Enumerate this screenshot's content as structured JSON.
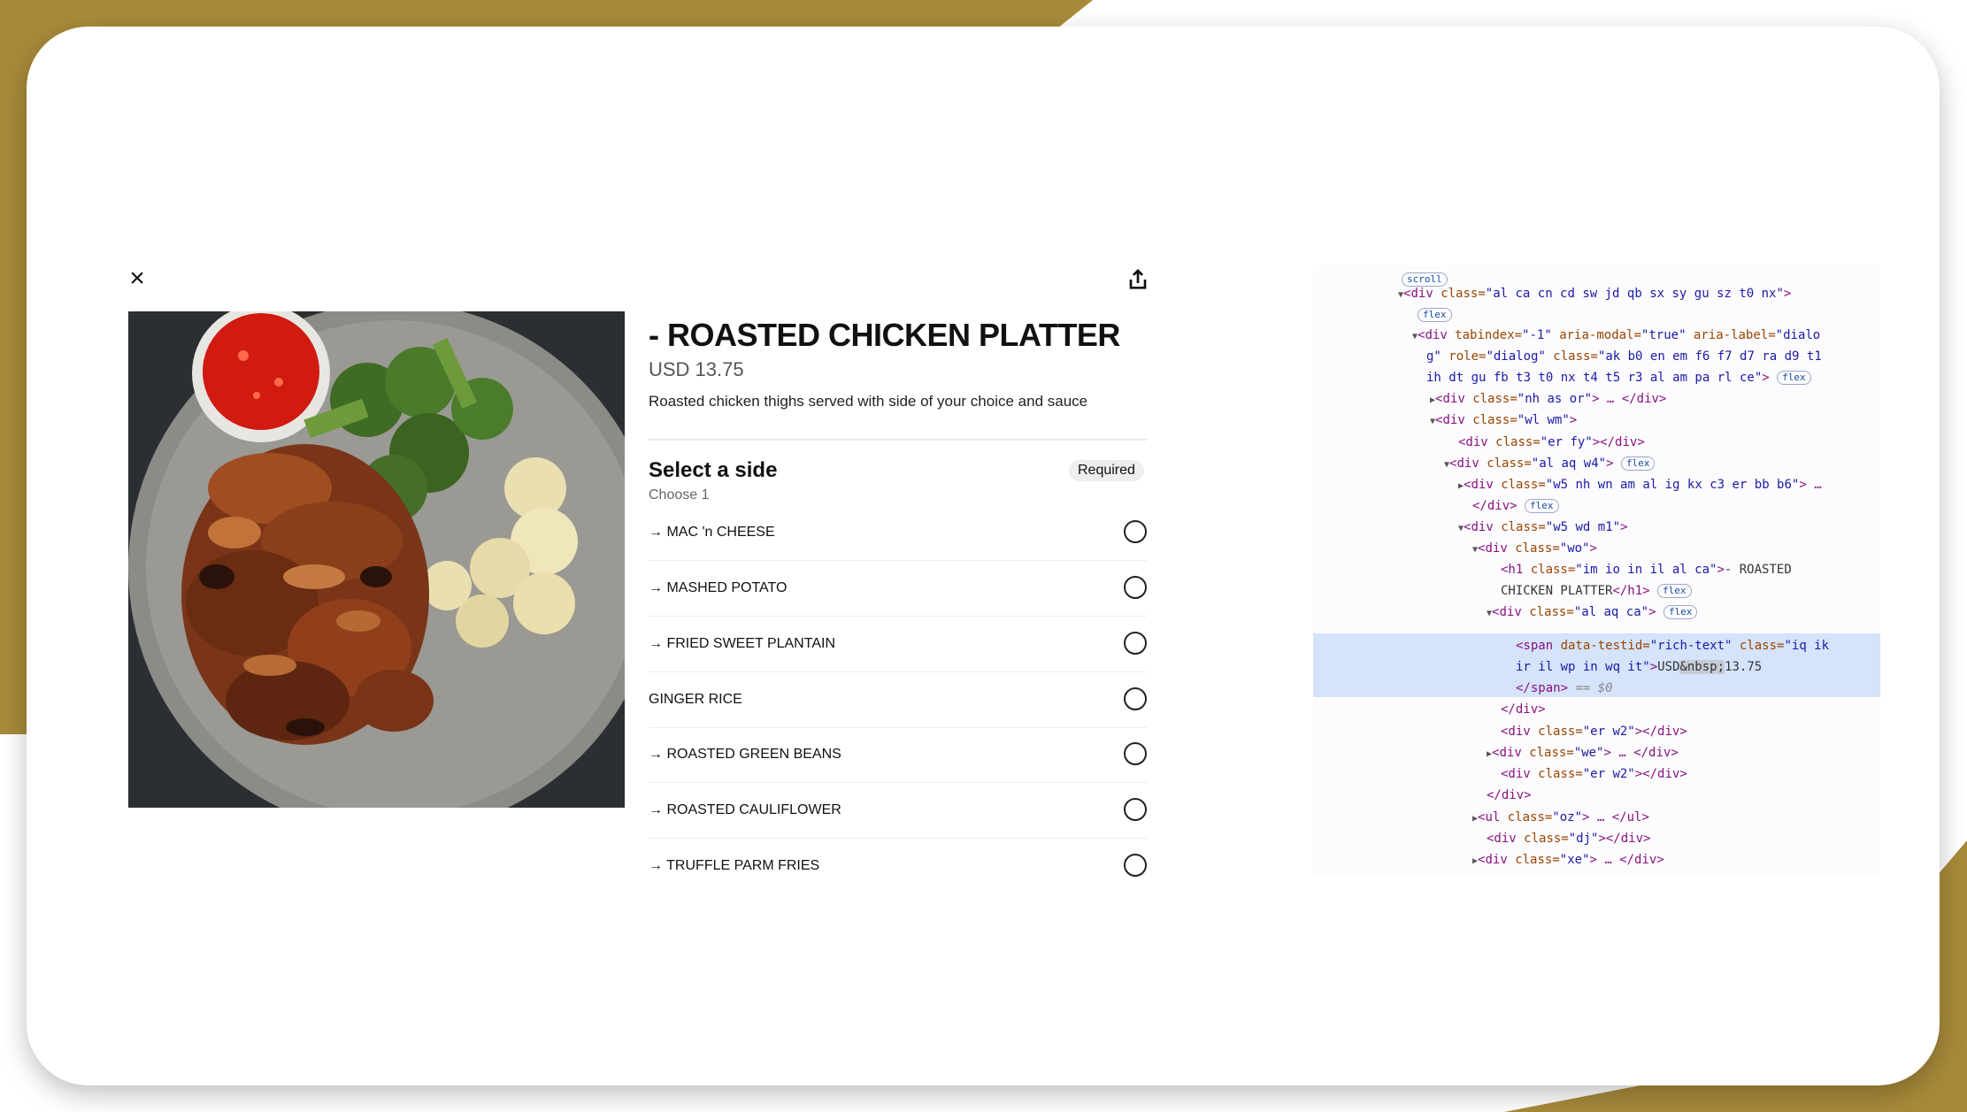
{
  "modal": {
    "close_icon": "×",
    "share_icon": "share-icon",
    "image_name": "roasted-chicken-platter-photo",
    "title": "- ROASTED CHICKEN PLATTER",
    "price": "USD 13.75",
    "description": "Roasted chicken thighs served with side of your choice and sauce",
    "section": {
      "title": "Select a side",
      "subtitle": "Choose 1",
      "badge": "Required"
    },
    "options": [
      {
        "label": "→ MAC 'n CHEESE"
      },
      {
        "label": "→ MASHED POTATO"
      },
      {
        "label": "→ FRIED SWEET PLANTAIN"
      },
      {
        "label": "GINGER RICE"
      },
      {
        "label": "→ ROASTED GREEN BEANS"
      },
      {
        "label": "→ ROASTED CAULIFLOWER"
      },
      {
        "label": "→ TRUFFLE PARM FRIES"
      }
    ]
  },
  "devtools": {
    "scroll_badge": "scroll",
    "flex_badge": "flex",
    "dollar_zero": "== $0",
    "lines": {
      "l1_tag": "<div ",
      "l1_attr": "class=",
      "l1_val": "\"al ca cn cd sw jd qb sx sy gu sz t0 nx\"",
      "l1_end": ">",
      "l2_tag": "<div ",
      "l2_a1": "tabindex=",
      "l2_v1": "\"-1\"",
      "l2_a2": " aria-modal=",
      "l2_v2": "\"true\"",
      "l2_a3": " aria-label=",
      "l2_v3": "\"dialo",
      "l3_v": "g\"",
      "l3_a1": " role=",
      "l3_v1": "\"dialog\"",
      "l3_a2": " class=",
      "l3_v2": "\"ak b0 en em f6 f7 d7 ra d9 t1",
      "l4_v": "ih dt gu fb t3 t0 nx t4 t5 r3 al am pa rl ce\"",
      "l4_end": ">",
      "l5_tag": "<div ",
      "l5_attr": "class=",
      "l5_val": "\"nh as or\"",
      "l5_end": "> … </div>",
      "l6_tag": "<div ",
      "l6_attr": "class=",
      "l6_val": "\"wl wm\"",
      "l6_end": ">",
      "l7_tag": "<div ",
      "l7_attr": "class=",
      "l7_val": "\"er fy\"",
      "l7_end": "></div>",
      "l8_tag": "<div ",
      "l8_attr": "class=",
      "l8_val": "\"al aq w4\"",
      "l8_end": ">",
      "l9_tag": "<div ",
      "l9_attr": "class=",
      "l9_val": "\"w5 nh wn am al ig kx c3 er bb b6\"",
      "l9_end": "> …",
      "l10_tag": "</div>",
      "l11_tag": "<div ",
      "l11_attr": "class=",
      "l11_val": "\"w5 wd m1\"",
      "l11_end": ">",
      "l12_tag": "<div ",
      "l12_attr": "class=",
      "l12_val": "\"wo\"",
      "l12_end": ">",
      "l13_tag": "<h1 ",
      "l13_attr": "class=",
      "l13_val": "\"im io in il al ca\"",
      "l13_end": ">",
      "l13_text": "- ROASTED",
      "l14_text": "CHICKEN PLATTER",
      "l14_end": "</h1>",
      "l15_tag": "<div ",
      "l15_attr": "class=",
      "l15_val": "\"al aq ca\"",
      "l15_end": ">",
      "l16_tag": "<span ",
      "l16_a1": "data-testid=",
      "l16_v1": "\"rich-text\"",
      "l16_a2": " class=",
      "l16_v2": "\"iq ik",
      "l17_v": "ir il wp in wq it\"",
      "l17_end": ">",
      "l17_t1": "USD",
      "l17_sel": "&nbsp;",
      "l17_t2": "13.75",
      "l18_tag": "</span>",
      "l19_tag": "</div>",
      "l20_tag": "<div ",
      "l20_attr": "class=",
      "l20_val": "\"er w2\"",
      "l20_end": "></div>",
      "l21_tag": "<div ",
      "l21_attr": "class=",
      "l21_val": "\"we\"",
      "l21_end": "> … </div>",
      "l22_tag": "<div ",
      "l22_attr": "class=",
      "l22_val": "\"er w2\"",
      "l22_end": "></div>",
      "l23_tag": "</div>",
      "l24_tag": "<ul ",
      "l24_attr": "class=",
      "l24_val": "\"oz\"",
      "l24_end": "> … </ul>",
      "l25_tag": "<div ",
      "l25_attr": "class=",
      "l25_val": "\"dj\"",
      "l25_end": "></div>",
      "l26_tag": "<div ",
      "l26_attr": "class=",
      "l26_val": "\"xe\"",
      "l26_end": "> … </div>"
    }
  },
  "colors": {
    "gold_background": "#a88a3a",
    "tag": "#881280",
    "attr": "#994500",
    "value": "#1a1aa6",
    "highlight": "#d5e3fb"
  }
}
